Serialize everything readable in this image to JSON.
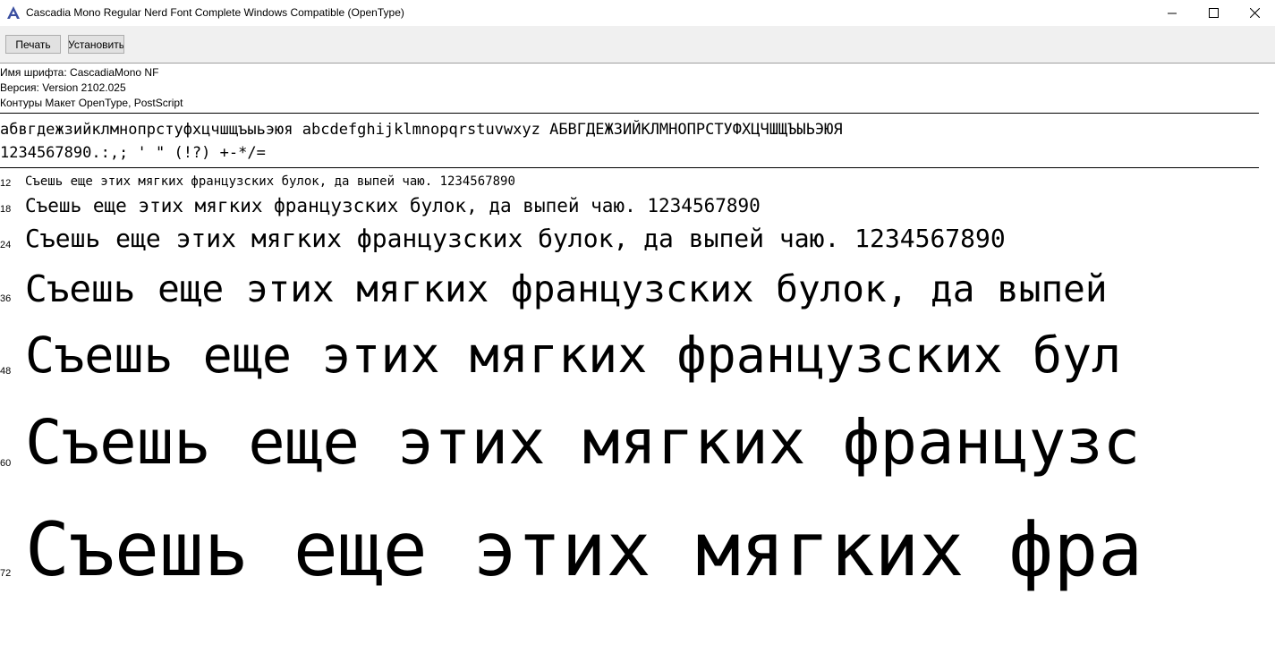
{
  "window": {
    "title": "Cascadia Mono Regular Nerd Font Complete Windows Compatible (OpenType)"
  },
  "toolbar": {
    "print_label": "Печать",
    "install_label": "Установить"
  },
  "font_info": {
    "name_line": "Имя шрифта: CascadiaMono NF",
    "version_line": "Версия: Version 2102.025",
    "outline_line": "Контуры Макет OpenType, PostScript"
  },
  "charset": {
    "line1": "абвгдежзийклмнопрстуфхцчшщъыьэюя abcdefghijklmnopqrstuvwxyz АБВГДЕЖЗИЙКЛМНОПРСТУФХЦЧШЩЪЫЬЭЮЯ",
    "line2": "1234567890.:,; ' \" (!?) +-*/="
  },
  "samples": [
    {
      "size": "12",
      "text": "Съешь еще этих мягких французских булок, да выпей чаю. 1234567890"
    },
    {
      "size": "18",
      "text": "Съешь еще этих мягких французских булок, да выпей чаю. 1234567890"
    },
    {
      "size": "24",
      "text": "Съешь еще этих мягких французских булок, да выпей чаю. 1234567890"
    },
    {
      "size": "36",
      "text": "Съешь еще этих мягких французских булок, да выпей"
    },
    {
      "size": "48",
      "text": "Съешь еще этих мягких французских бул"
    },
    {
      "size": "60",
      "text": "Съешь еще этих мягких французс"
    },
    {
      "size": "72",
      "text": "Съешь еще этих мягких фра"
    }
  ]
}
